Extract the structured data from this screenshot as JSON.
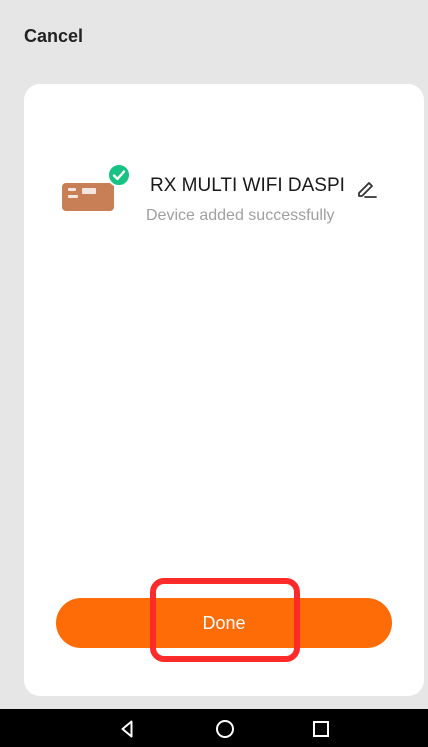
{
  "header": {
    "cancel_label": "Cancel"
  },
  "device": {
    "name": "RX MULTI WIFI DASPI",
    "status": "Device added successfully",
    "image_icon": "device-module-icon",
    "badge_icon": "check-circle-icon",
    "badge_color": "#17c384"
  },
  "actions": {
    "done_label": "Done",
    "done_color": "#fe6c08",
    "highlight_color": "#ff2a2a"
  },
  "navigation": {
    "back_icon": "back-triangle-icon",
    "home_icon": "home-circle-icon",
    "recents_icon": "recents-square-icon"
  }
}
